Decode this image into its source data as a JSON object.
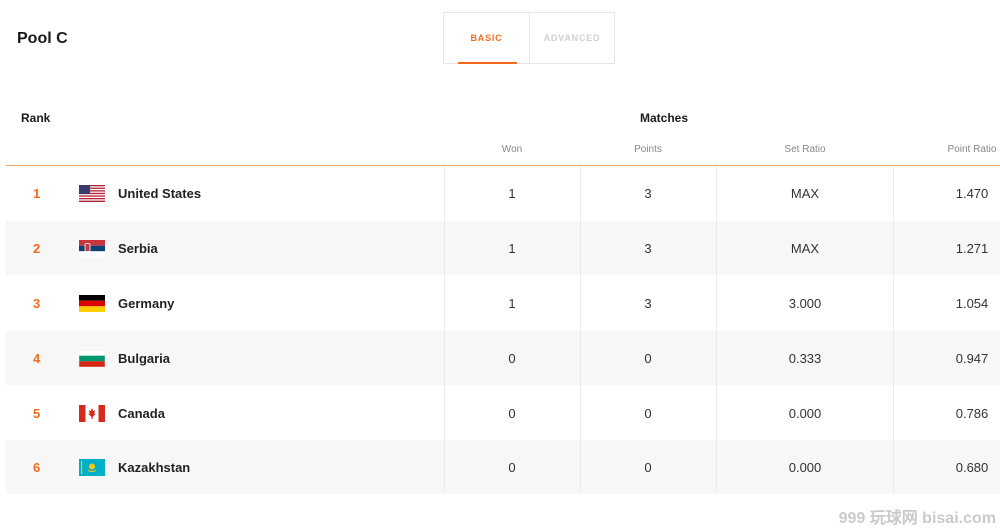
{
  "pool_title": "Pool C",
  "tabs": [
    {
      "label": "BASIC",
      "active": true
    },
    {
      "label": "ADVANCED",
      "active": false
    }
  ],
  "headers": {
    "rank": "Rank",
    "matches": "Matches",
    "columns": [
      "Won",
      "Points",
      "Set Ratio",
      "Point Ratio"
    ]
  },
  "accent_color": "#f26b1d",
  "rows": [
    {
      "rank": "1",
      "flag": "us-flag-icon",
      "team": "United States",
      "won": "1",
      "points": "3",
      "set_ratio": "MAX",
      "point_ratio": "1.470"
    },
    {
      "rank": "2",
      "flag": "serbia-flag-icon",
      "team": "Serbia",
      "won": "1",
      "points": "3",
      "set_ratio": "MAX",
      "point_ratio": "1.271"
    },
    {
      "rank": "3",
      "flag": "germany-flag-icon",
      "team": "Germany",
      "won": "1",
      "points": "3",
      "set_ratio": "3.000",
      "point_ratio": "1.054"
    },
    {
      "rank": "4",
      "flag": "bulgaria-flag-icon",
      "team": "Bulgaria",
      "won": "0",
      "points": "0",
      "set_ratio": "0.333",
      "point_ratio": "0.947"
    },
    {
      "rank": "5",
      "flag": "canada-flag-icon",
      "team": "Canada",
      "won": "0",
      "points": "0",
      "set_ratio": "0.000",
      "point_ratio": "0.786"
    },
    {
      "rank": "6",
      "flag": "kazakhstan-flag-icon",
      "team": "Kazakhstan",
      "won": "0",
      "points": "0",
      "set_ratio": "0.000",
      "point_ratio": "0.680"
    }
  ],
  "watermark": "999 玩球网 bisai.com"
}
